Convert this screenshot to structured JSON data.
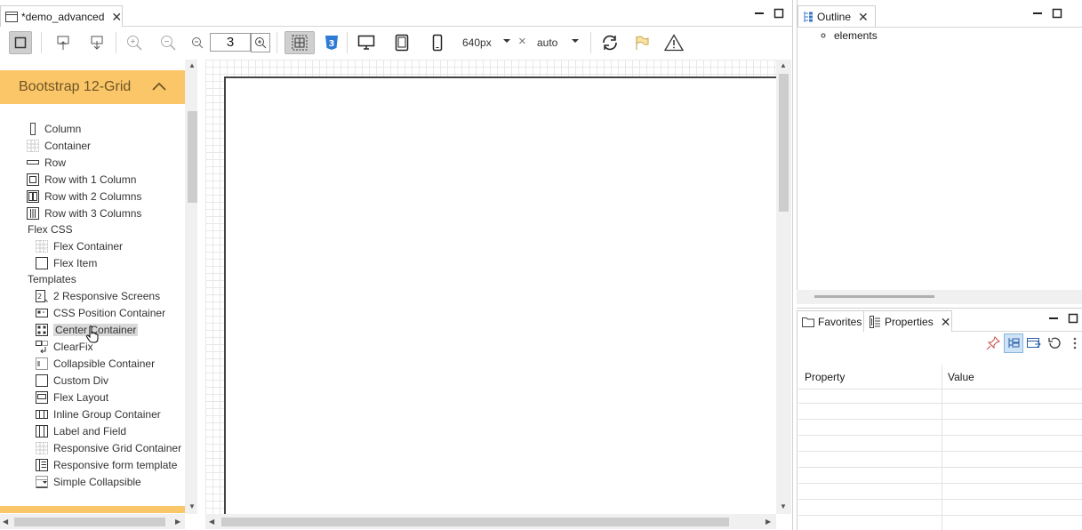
{
  "editor": {
    "tab_title": "*demo_advanced",
    "zoom_value": "3",
    "width_value": "640px",
    "height_value": "auto",
    "times_glyph": "×"
  },
  "palette": {
    "header": "Bootstrap 12-Grid",
    "items": [
      {
        "label": "Column",
        "icon": "column-icon"
      },
      {
        "label": "Container",
        "icon": "container-icon"
      },
      {
        "label": "Row",
        "icon": "row-icon"
      },
      {
        "label": "Row with 1 Column",
        "icon": "row-1col-icon"
      },
      {
        "label": "Row with 2 Columns",
        "icon": "row-2col-icon"
      },
      {
        "label": "Row with 3 Columns",
        "icon": "row-3col-icon"
      }
    ],
    "categories": [
      "Flex CSS",
      "Templates"
    ],
    "flex_items": [
      {
        "label": "Flex Container",
        "icon": "flex-container-icon"
      },
      {
        "label": "Flex Item",
        "icon": "flex-item-icon"
      }
    ],
    "template_items": [
      {
        "label": "2 Responsive Screens",
        "icon": "responsive-screens-icon"
      },
      {
        "label": "CSS Position Container",
        "icon": "css-position-icon"
      },
      {
        "label": "Center Container",
        "icon": "center-container-icon"
      },
      {
        "label": "ClearFix",
        "icon": "clearfix-icon"
      },
      {
        "label": "Collapsible Container",
        "icon": "collapsible-icon"
      },
      {
        "label": "Custom Div",
        "icon": "custom-div-icon"
      },
      {
        "label": "Flex Layout",
        "icon": "flex-layout-icon"
      },
      {
        "label": "Inline Group Container",
        "icon": "inline-group-icon"
      },
      {
        "label": "Label and Field",
        "icon": "label-field-icon"
      },
      {
        "label": "Responsive Grid Container",
        "icon": "responsive-grid-icon"
      },
      {
        "label": "Responsive form template",
        "icon": "responsive-form-icon"
      },
      {
        "label": "Simple Collapsible",
        "icon": "simple-collapsible-icon"
      }
    ]
  },
  "outline": {
    "tab_title": "Outline",
    "tree_item": "elements"
  },
  "properties": {
    "tab_favorites": "Favorites",
    "tab_properties": "Properties",
    "col_property": "Property",
    "col_value": "Value"
  },
  "colors": {
    "palette_accent": "#fbc667",
    "palette_header_text": "#6e5528",
    "css3_blue": "#2d7bd4"
  }
}
